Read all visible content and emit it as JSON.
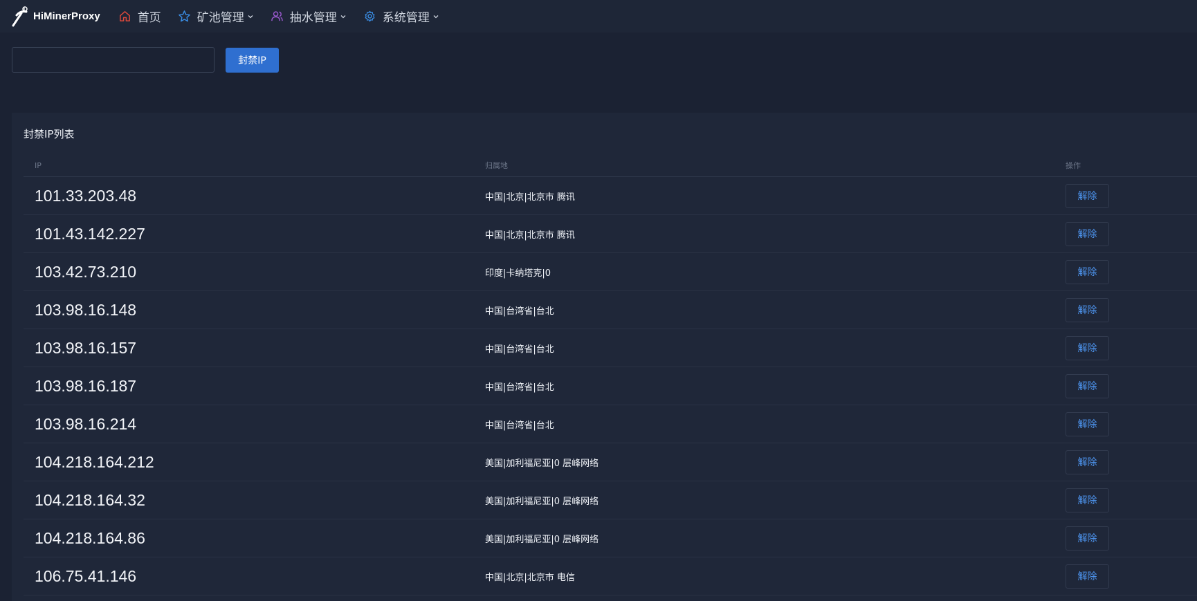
{
  "brand": {
    "name": "HiMinerProxy"
  },
  "nav": [
    {
      "label": "首页",
      "icon": "home-icon",
      "color": "#d9483b",
      "dropdown": false
    },
    {
      "label": "矿池管理",
      "icon": "star-icon",
      "color": "#3a8ee6",
      "dropdown": true
    },
    {
      "label": "抽水管理",
      "icon": "users-icon",
      "color": "#9b59d0",
      "dropdown": true
    },
    {
      "label": "系统管理",
      "icon": "gear-icon",
      "color": "#3a8ee6",
      "dropdown": true
    }
  ],
  "ban": {
    "input_value": "",
    "input_placeholder": "",
    "button_label": "封禁IP"
  },
  "card": {
    "title": "封禁IP列表",
    "columns": {
      "ip": "IP",
      "location": "归属地",
      "action": "操作"
    },
    "rows": [
      {
        "ip": "101.33.203.48",
        "location": "中国|北京|北京市 腾讯",
        "action": "解除"
      },
      {
        "ip": "101.43.142.227",
        "location": "中国|北京|北京市 腾讯",
        "action": "解除"
      },
      {
        "ip": "103.42.73.210",
        "location": "印度|卡纳塔克|0",
        "action": "解除"
      },
      {
        "ip": "103.98.16.148",
        "location": "中国|台湾省|台北",
        "action": "解除"
      },
      {
        "ip": "103.98.16.157",
        "location": "中国|台湾省|台北",
        "action": "解除"
      },
      {
        "ip": "103.98.16.187",
        "location": "中国|台湾省|台北",
        "action": "解除"
      },
      {
        "ip": "103.98.16.214",
        "location": "中国|台湾省|台北",
        "action": "解除"
      },
      {
        "ip": "104.218.164.212",
        "location": "美国|加利福尼亚|0 层峰网络",
        "action": "解除"
      },
      {
        "ip": "104.218.164.32",
        "location": "美国|加利福尼亚|0 层峰网络",
        "action": "解除"
      },
      {
        "ip": "104.218.164.86",
        "location": "美国|加利福尼亚|0 层峰网络",
        "action": "解除"
      },
      {
        "ip": "106.75.41.146",
        "location": "中国|北京|北京市 电信",
        "action": "解除"
      }
    ]
  }
}
